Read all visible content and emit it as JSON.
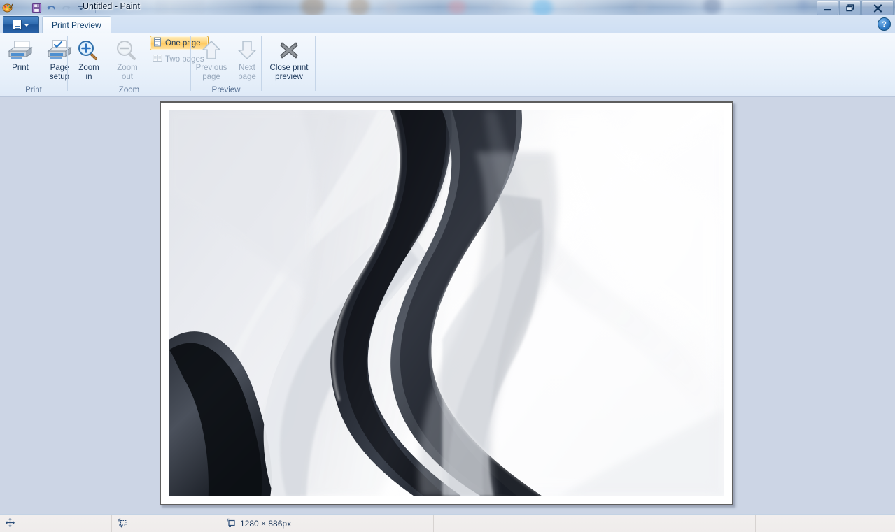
{
  "window": {
    "title": "Untitled - Paint",
    "app_name": "Paint",
    "document_name": "Untitled"
  },
  "quick_access": {
    "items": [
      {
        "name": "paint-app-icon",
        "label": "Paint",
        "enabled": true
      },
      {
        "name": "save-icon",
        "label": "Save",
        "enabled": true
      },
      {
        "name": "undo-icon",
        "label": "Undo",
        "enabled": true
      },
      {
        "name": "redo-icon",
        "label": "Redo",
        "enabled": false
      },
      {
        "name": "customize-quick-access-toolbar-icon",
        "label": "Customize Quick Access Toolbar",
        "enabled": true
      }
    ]
  },
  "window_controls": {
    "minimize": "Minimize",
    "restore": "Restore Down",
    "close": "Close"
  },
  "ribbon": {
    "menu_button_label": "Paint",
    "tabs": [
      {
        "label": "Print Preview",
        "active": true
      }
    ],
    "help_label": "?",
    "groups": [
      {
        "label": "Print",
        "buttons": [
          {
            "name": "print-button",
            "label_line1": "Print",
            "label_line2": "",
            "icon": "printer-icon",
            "enabled": true
          },
          {
            "name": "page-setup-button",
            "label_line1": "Page",
            "label_line2": "setup",
            "icon": "page-setup-icon",
            "enabled": true
          }
        ]
      },
      {
        "label": "Zoom",
        "buttons": [
          {
            "name": "zoom-in-button",
            "label_line1": "Zoom",
            "label_line2": "in",
            "icon": "magnifier-plus-icon",
            "enabled": true
          },
          {
            "name": "zoom-out-button",
            "label_line1": "Zoom",
            "label_line2": "out",
            "icon": "magnifier-minus-icon",
            "enabled": false
          }
        ],
        "toggles": [
          {
            "name": "one-page-button",
            "label": "One page",
            "icon": "one-page-icon",
            "checked": true,
            "enabled": true
          },
          {
            "name": "two-pages-button",
            "label": "Two pages",
            "icon": "two-pages-icon",
            "checked": false,
            "enabled": false
          }
        ]
      },
      {
        "label": "Preview",
        "buttons": [
          {
            "name": "previous-page-button",
            "label_line1": "Previous",
            "label_line2": "page",
            "icon": "arrow-up-icon",
            "enabled": false
          },
          {
            "name": "next-page-button",
            "label_line1": "Next",
            "label_line2": "page",
            "icon": "arrow-down-icon",
            "enabled": false
          },
          {
            "name": "close-print-preview-button",
            "label_line1": "Close print",
            "label_line2": "preview",
            "icon": "close-x-icon",
            "enabled": true
          }
        ]
      }
    ]
  },
  "preview": {
    "page_count": 1,
    "current_page": 1,
    "content_description": "abstract grayscale flowing wave artwork"
  },
  "status_bar": {
    "cells": [
      {
        "name": "cursor-position-cell",
        "icon": "move-cursor-icon",
        "text": ""
      },
      {
        "name": "selection-size-cell",
        "icon": "selection-size-icon",
        "text": ""
      },
      {
        "name": "image-size-cell",
        "icon": "image-size-icon",
        "text": "1280 × 886px"
      },
      {
        "name": "file-size-cell",
        "icon": "",
        "text": ""
      },
      {
        "name": "zoom-slider-cell",
        "icon": "",
        "text": ""
      }
    ]
  },
  "colors": {
    "accent_orange": "#ffc85c",
    "canvas_background": "#ccd5e5",
    "ribbon_background": "#eaf2fb",
    "status_background": "#f0edec",
    "title_text": "#0b1c33",
    "disabled_text": "#9aaabd"
  }
}
